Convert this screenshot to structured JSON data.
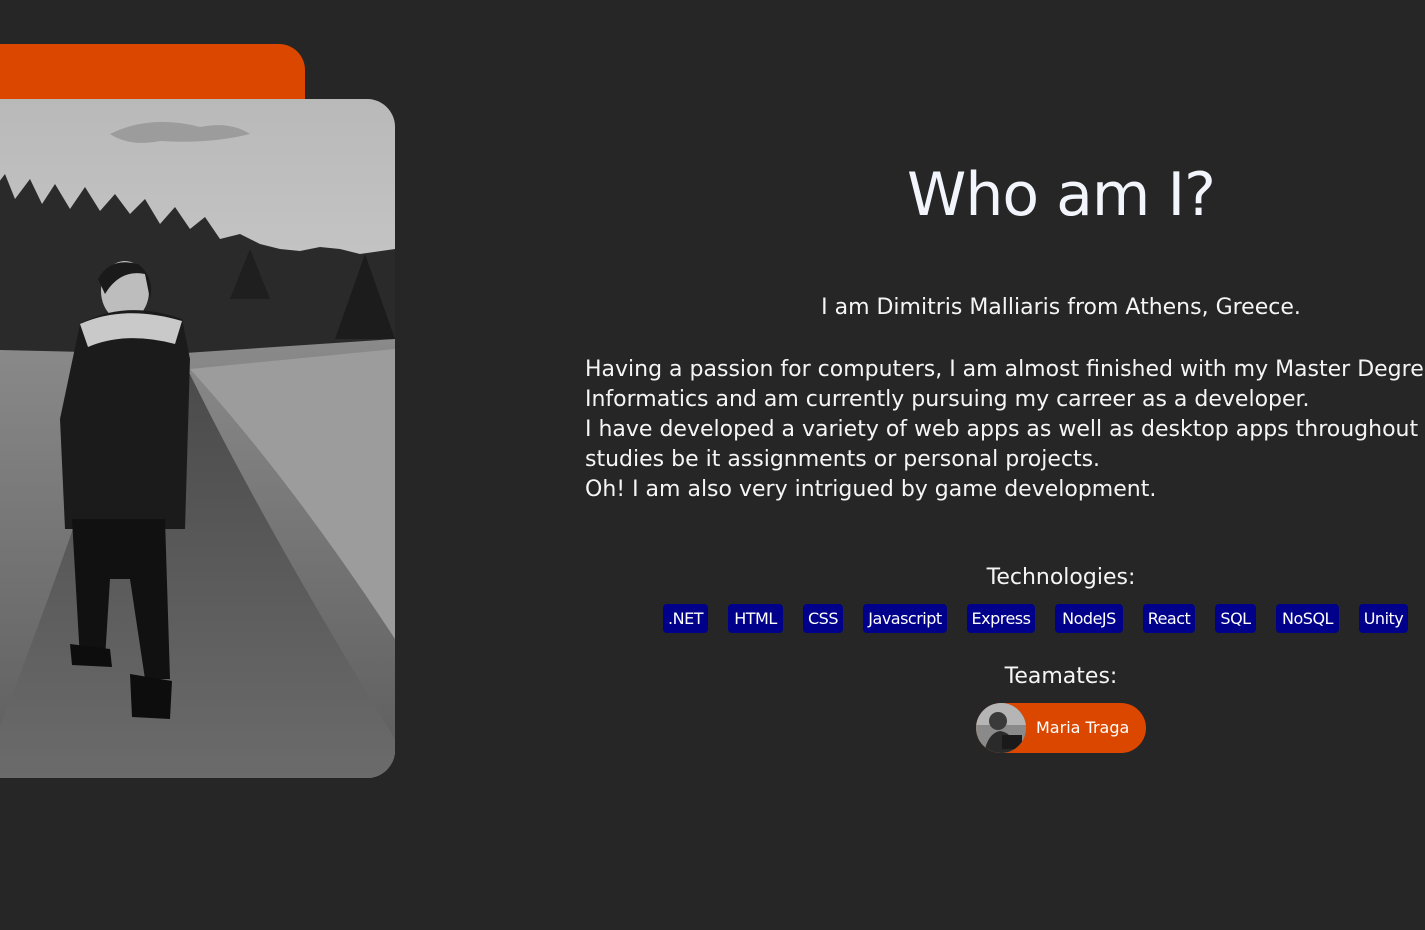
{
  "about": {
    "title": "Who am I?",
    "intro": "I am Dimitris Malliaris from Athens, Greece.",
    "bio_lines": [
      "Having a passion for computers, I am almost finished with my Master Degree in",
      "Informatics and am currently pursuing my carreer as a developer.",
      "I have developed a variety of web apps as well as desktop apps throughout my",
      "studies be it assignments or personal projects.",
      "Oh! I am also very intrigued by game development."
    ]
  },
  "technologies": {
    "label": "Technologies:",
    "items": [
      ".NET",
      "HTML",
      "CSS",
      "Javascript",
      "Express",
      "NodeJS",
      "React",
      "SQL",
      "NoSQL",
      "Unity"
    ]
  },
  "teammates": {
    "label": "Teamates:",
    "items": [
      {
        "name": "Maria Traga"
      }
    ]
  },
  "colors": {
    "background": "#262626",
    "accent": "#dc4700",
    "tag_background": "#00008b",
    "text": "#f5f5f5"
  }
}
